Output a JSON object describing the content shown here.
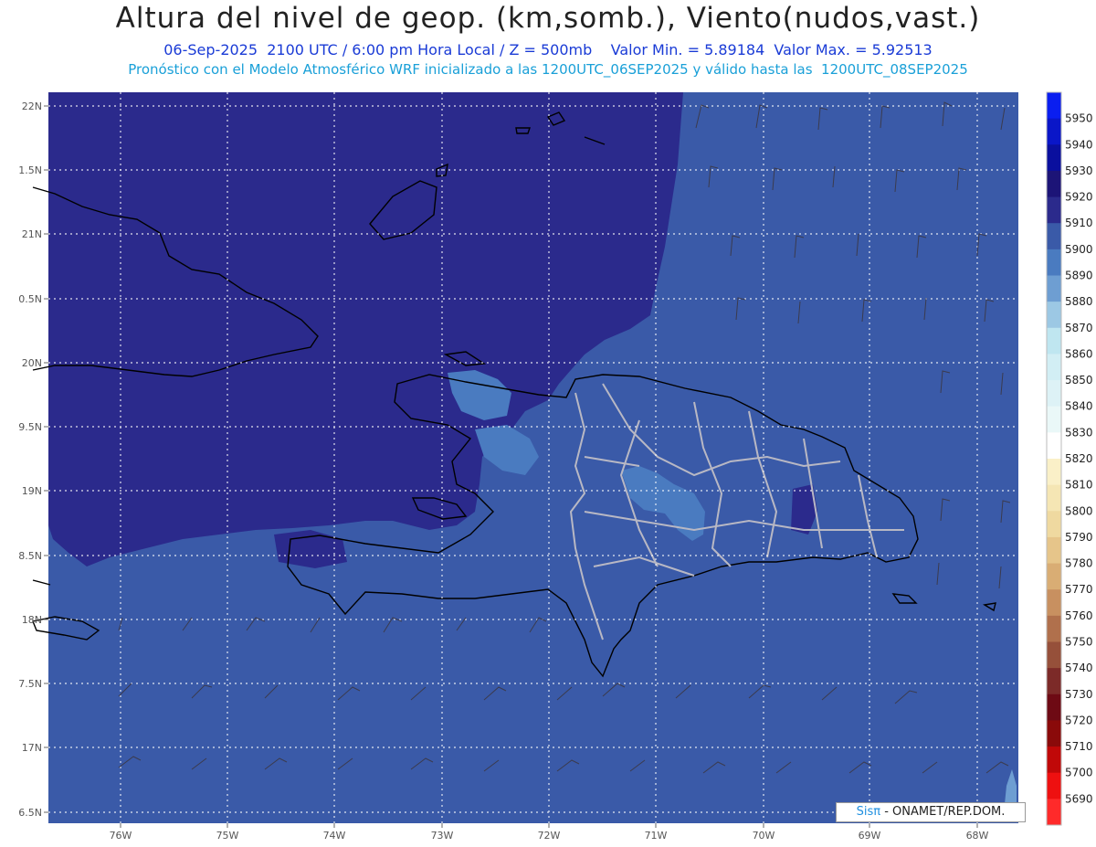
{
  "header": {
    "title": "Altura del nivel de geop. (km,somb.), Viento(nudos,vast.)",
    "line1": "06-Sep-2025  2100 UTC / 6:00 pm Hora Local / Z = 500mb    Valor Min. = 5.89184  Valor Max. = 5.92513",
    "line2": "Pronóstico con el Modelo Atmosférico WRF inicializado a las 1200UTC_06SEP2025 y válido hasta las  1200UTC_08SEP2025"
  },
  "axes": {
    "lat_labels": [
      "22N",
      "1.5N",
      "21N",
      "0.5N",
      "20N",
      "9.5N",
      "19N",
      "8.5N",
      "18N",
      "7.5N",
      "17N",
      "6.5N"
    ],
    "lon_labels": [
      "76W",
      "75W",
      "74W",
      "73W",
      "72W",
      "71W",
      "70W",
      "69W",
      "68W"
    ]
  },
  "colorbar": {
    "labels": [
      "5950",
      "5940",
      "5930",
      "5920",
      "5910",
      "5900",
      "5890",
      "5880",
      "5870",
      "5860",
      "5850",
      "5840",
      "5830",
      "5820",
      "5810",
      "5800",
      "5790",
      "5780",
      "5770",
      "5760",
      "5750",
      "5740",
      "5730",
      "5720",
      "5710",
      "5700",
      "5690"
    ],
    "colors": [
      "#0a1ef0",
      "#0a16c8",
      "#0a0f9e",
      "#1c1477",
      "#2b2a8c",
      "#3a5aa8",
      "#4a7bc0",
      "#6e9ed2",
      "#9cc8e4",
      "#bfe6f0",
      "#d2eef4",
      "#ddf2f6",
      "#eaf8f8",
      "#ffffff",
      "#faf0c8",
      "#f5e6b4",
      "#efd9a0",
      "#e6c58a",
      "#d9ad74",
      "#c89060",
      "#b0704c",
      "#96503a",
      "#7c2a28",
      "#6e0a14",
      "#8a0a0a",
      "#c00808",
      "#ee1010",
      "#ff2a2a"
    ]
  },
  "legend_colors": {
    "dark_region": "#2b2a8c",
    "mid_region": "#3a5aa8",
    "light_region": "#4a7bc0",
    "lighter_region": "#6e9ed2"
  },
  "credit": {
    "sis": "Sisπ",
    "text": " - ONAMET/REP.DOM."
  }
}
